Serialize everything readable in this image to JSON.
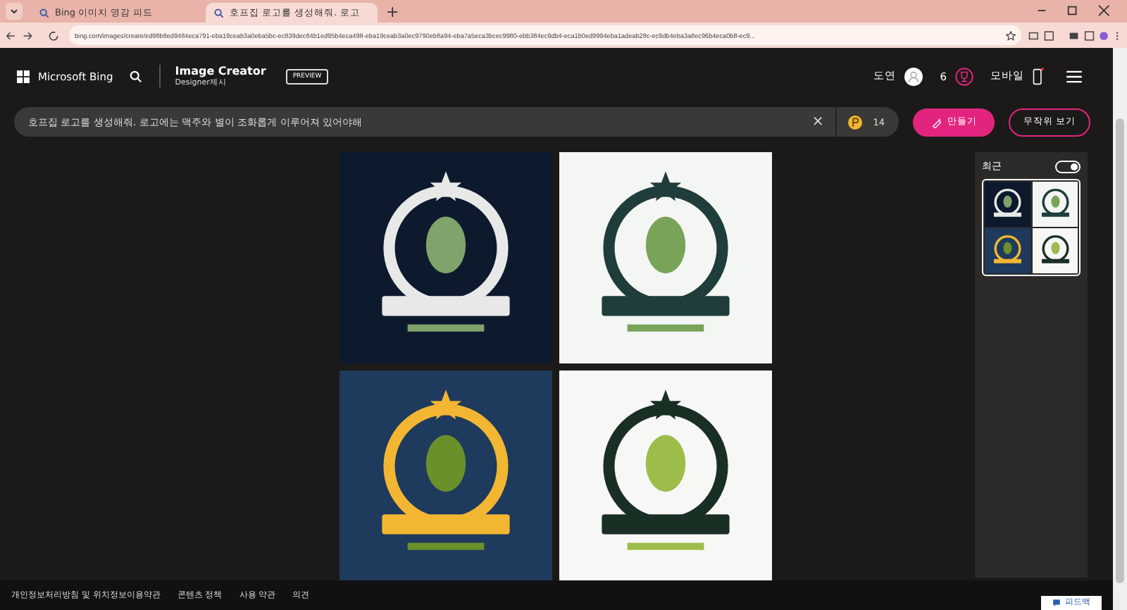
{
  "browser": {
    "tabs": [
      {
        "title": "Bing 이미지 영감 피드",
        "selected": false
      },
      {
        "title": "호프집 로고를 생성해줘. 로고",
        "selected": true
      }
    ],
    "new_tab": "+",
    "address": "bing.com/images/create/ed98b8ed9484eca791-eba19ceab3a0eba5bc-ec839dec84b1ed95b4eca498-eba19ceab3a0ec9790eb8a94-eba7a5eca3bcec9980-ebb384ec9db4-eca1b0ed9994eba1adeab28c-ec9db4eba3a8ec96b4eca0b8-ec9..."
  },
  "header": {
    "brand": "Microsoft Bing",
    "product": "Image Creator",
    "subtitle": "Designer제시",
    "badge": "PREVIEW",
    "user": "도연",
    "points": "6",
    "mobile": "모바일"
  },
  "prompt": {
    "value": "호프집 로고를 생성해줘. 로고에는 맥주와 별이 조화롭게 이루어져 있어야해",
    "clear": "×",
    "boosts": "14",
    "create": "만들기",
    "surprise": "무작위 보기"
  },
  "recent": {
    "title": "최근",
    "toggle_on": true
  },
  "footer": {
    "links": [
      "개인정보처리방침 및 위치정보이용약관",
      "콘텐츠 정책",
      "사용 약관",
      "의견"
    ],
    "feedback": "피드백"
  }
}
